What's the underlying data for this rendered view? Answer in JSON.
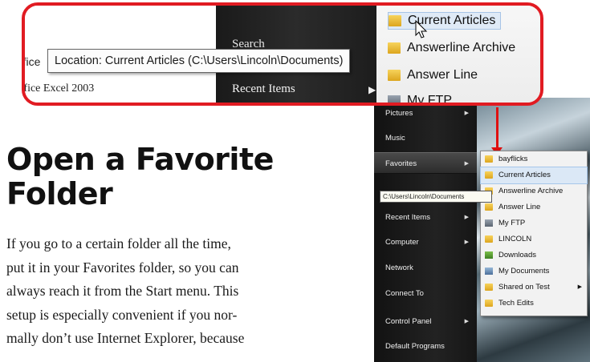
{
  "article": {
    "heading_line1": "Open a Favorite",
    "heading_line2": "Folder",
    "body_lines": [
      "If you go to a certain folder all the time,",
      "put it in your Favorites folder, so you can",
      "always reach it from the Start menu. This",
      "setup is especially convenient if you nor-",
      "mally don’t use Internet Explorer, because"
    ]
  },
  "zoom": {
    "left_line1": "ffice",
    "left_line2": "ffice Excel 2003",
    "search_label": "Search",
    "recent_label": "Recent Items",
    "tooltip": "Location: Current Articles (C:\\Users\\Lincoln\\Documents)",
    "items": [
      "Current Articles",
      "Answerline Archive",
      "Answer Line",
      "My FTP"
    ]
  },
  "start_menu": {
    "items": [
      {
        "label": "Pictures",
        "arrow": true
      },
      {
        "label": "Music",
        "arrow": false
      },
      {
        "label": "Favorites",
        "arrow": true
      },
      {
        "label": "",
        "arrow": false
      },
      {
        "label": "Recent Items",
        "arrow": true
      },
      {
        "label": "Computer",
        "arrow": true
      },
      {
        "label": "Network",
        "arrow": false
      },
      {
        "label": "Connect To",
        "arrow": false
      },
      {
        "label": "Control Panel",
        "arrow": true
      },
      {
        "label": "Default Programs",
        "arrow": false
      }
    ],
    "selected_index": 2,
    "tooltip": "C:\\Users\\Lincoln\\Documents",
    "favorites": [
      {
        "label": "bayflicks",
        "icon": "folder-icon",
        "arrow": false
      },
      {
        "label": "Current Articles",
        "icon": "folder-icon",
        "arrow": false
      },
      {
        "label": "Answerline Archive",
        "icon": "folder-icon",
        "arrow": false
      },
      {
        "label": "Answer Line",
        "icon": "folder-icon",
        "arrow": false
      },
      {
        "label": "My FTP",
        "icon": "network-drive-icon",
        "arrow": false
      },
      {
        "label": "LINCOLN",
        "icon": "folder-icon",
        "arrow": false
      },
      {
        "label": "Downloads",
        "icon": "downloads-icon",
        "arrow": false
      },
      {
        "label": "My Documents",
        "icon": "documents-icon",
        "arrow": false
      },
      {
        "label": "Shared on Test",
        "icon": "folder-icon",
        "arrow": true
      },
      {
        "label": "Tech Edits",
        "icon": "folder-icon",
        "arrow": false
      }
    ],
    "highlighted_favorite": 1
  },
  "colors": {
    "callout_red": "#e11b22",
    "menu_dark": "#1a1a1a",
    "highlight": "#dbe8f6"
  }
}
